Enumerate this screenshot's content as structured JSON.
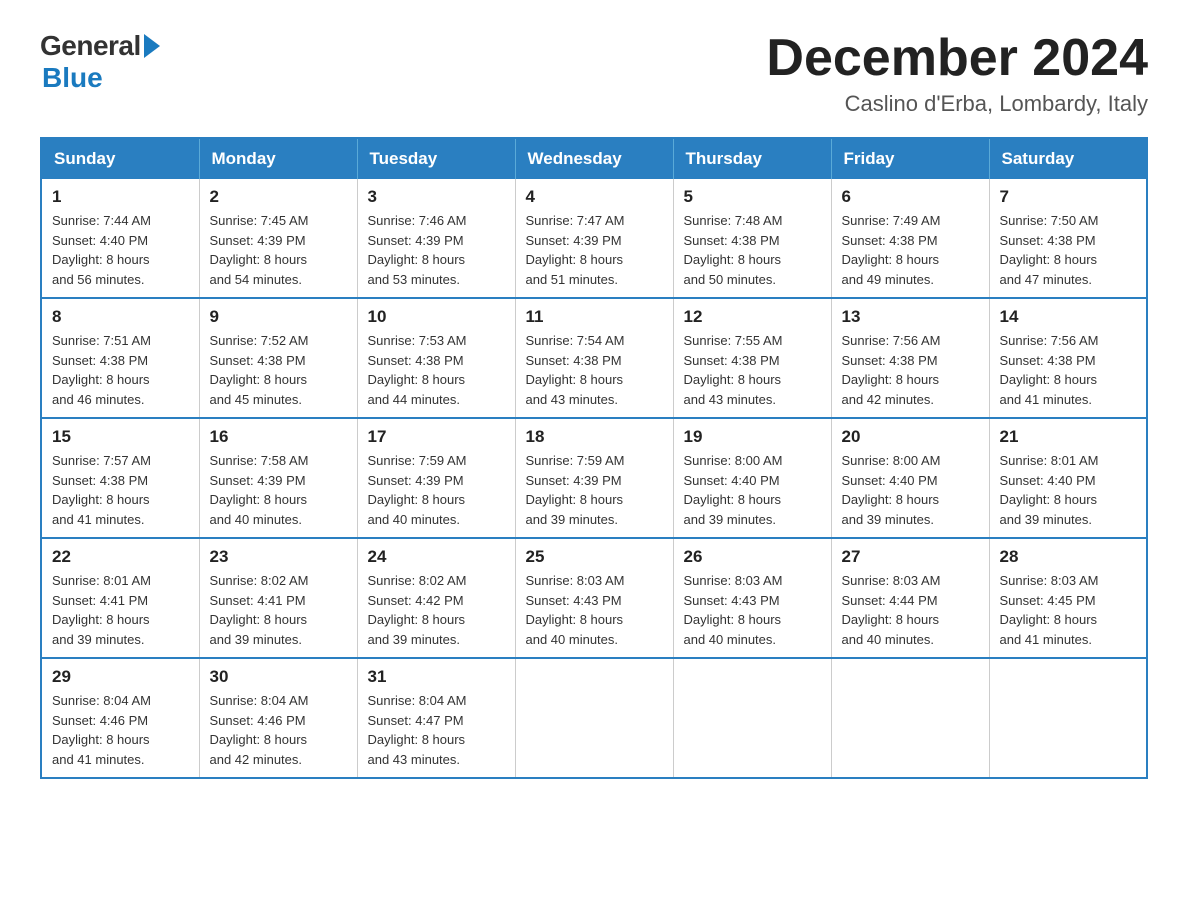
{
  "header": {
    "logo_general": "General",
    "logo_blue": "Blue",
    "month_title": "December 2024",
    "location": "Caslino d'Erba, Lombardy, Italy"
  },
  "days_of_week": [
    "Sunday",
    "Monday",
    "Tuesday",
    "Wednesday",
    "Thursday",
    "Friday",
    "Saturday"
  ],
  "weeks": [
    [
      {
        "day": "1",
        "sunrise": "7:44 AM",
        "sunset": "4:40 PM",
        "daylight": "8 hours and 56 minutes."
      },
      {
        "day": "2",
        "sunrise": "7:45 AM",
        "sunset": "4:39 PM",
        "daylight": "8 hours and 54 minutes."
      },
      {
        "day": "3",
        "sunrise": "7:46 AM",
        "sunset": "4:39 PM",
        "daylight": "8 hours and 53 minutes."
      },
      {
        "day": "4",
        "sunrise": "7:47 AM",
        "sunset": "4:39 PM",
        "daylight": "8 hours and 51 minutes."
      },
      {
        "day": "5",
        "sunrise": "7:48 AM",
        "sunset": "4:38 PM",
        "daylight": "8 hours and 50 minutes."
      },
      {
        "day": "6",
        "sunrise": "7:49 AM",
        "sunset": "4:38 PM",
        "daylight": "8 hours and 49 minutes."
      },
      {
        "day": "7",
        "sunrise": "7:50 AM",
        "sunset": "4:38 PM",
        "daylight": "8 hours and 47 minutes."
      }
    ],
    [
      {
        "day": "8",
        "sunrise": "7:51 AM",
        "sunset": "4:38 PM",
        "daylight": "8 hours and 46 minutes."
      },
      {
        "day": "9",
        "sunrise": "7:52 AM",
        "sunset": "4:38 PM",
        "daylight": "8 hours and 45 minutes."
      },
      {
        "day": "10",
        "sunrise": "7:53 AM",
        "sunset": "4:38 PM",
        "daylight": "8 hours and 44 minutes."
      },
      {
        "day": "11",
        "sunrise": "7:54 AM",
        "sunset": "4:38 PM",
        "daylight": "8 hours and 43 minutes."
      },
      {
        "day": "12",
        "sunrise": "7:55 AM",
        "sunset": "4:38 PM",
        "daylight": "8 hours and 43 minutes."
      },
      {
        "day": "13",
        "sunrise": "7:56 AM",
        "sunset": "4:38 PM",
        "daylight": "8 hours and 42 minutes."
      },
      {
        "day": "14",
        "sunrise": "7:56 AM",
        "sunset": "4:38 PM",
        "daylight": "8 hours and 41 minutes."
      }
    ],
    [
      {
        "day": "15",
        "sunrise": "7:57 AM",
        "sunset": "4:38 PM",
        "daylight": "8 hours and 41 minutes."
      },
      {
        "day": "16",
        "sunrise": "7:58 AM",
        "sunset": "4:39 PM",
        "daylight": "8 hours and 40 minutes."
      },
      {
        "day": "17",
        "sunrise": "7:59 AM",
        "sunset": "4:39 PM",
        "daylight": "8 hours and 40 minutes."
      },
      {
        "day": "18",
        "sunrise": "7:59 AM",
        "sunset": "4:39 PM",
        "daylight": "8 hours and 39 minutes."
      },
      {
        "day": "19",
        "sunrise": "8:00 AM",
        "sunset": "4:40 PM",
        "daylight": "8 hours and 39 minutes."
      },
      {
        "day": "20",
        "sunrise": "8:00 AM",
        "sunset": "4:40 PM",
        "daylight": "8 hours and 39 minutes."
      },
      {
        "day": "21",
        "sunrise": "8:01 AM",
        "sunset": "4:40 PM",
        "daylight": "8 hours and 39 minutes."
      }
    ],
    [
      {
        "day": "22",
        "sunrise": "8:01 AM",
        "sunset": "4:41 PM",
        "daylight": "8 hours and 39 minutes."
      },
      {
        "day": "23",
        "sunrise": "8:02 AM",
        "sunset": "4:41 PM",
        "daylight": "8 hours and 39 minutes."
      },
      {
        "day": "24",
        "sunrise": "8:02 AM",
        "sunset": "4:42 PM",
        "daylight": "8 hours and 39 minutes."
      },
      {
        "day": "25",
        "sunrise": "8:03 AM",
        "sunset": "4:43 PM",
        "daylight": "8 hours and 40 minutes."
      },
      {
        "day": "26",
        "sunrise": "8:03 AM",
        "sunset": "4:43 PM",
        "daylight": "8 hours and 40 minutes."
      },
      {
        "day": "27",
        "sunrise": "8:03 AM",
        "sunset": "4:44 PM",
        "daylight": "8 hours and 40 minutes."
      },
      {
        "day": "28",
        "sunrise": "8:03 AM",
        "sunset": "4:45 PM",
        "daylight": "8 hours and 41 minutes."
      }
    ],
    [
      {
        "day": "29",
        "sunrise": "8:04 AM",
        "sunset": "4:46 PM",
        "daylight": "8 hours and 41 minutes."
      },
      {
        "day": "30",
        "sunrise": "8:04 AM",
        "sunset": "4:46 PM",
        "daylight": "8 hours and 42 minutes."
      },
      {
        "day": "31",
        "sunrise": "8:04 AM",
        "sunset": "4:47 PM",
        "daylight": "8 hours and 43 minutes."
      },
      null,
      null,
      null,
      null
    ]
  ],
  "labels": {
    "sunrise_prefix": "Sunrise: ",
    "sunset_prefix": "Sunset: ",
    "daylight_prefix": "Daylight: "
  }
}
